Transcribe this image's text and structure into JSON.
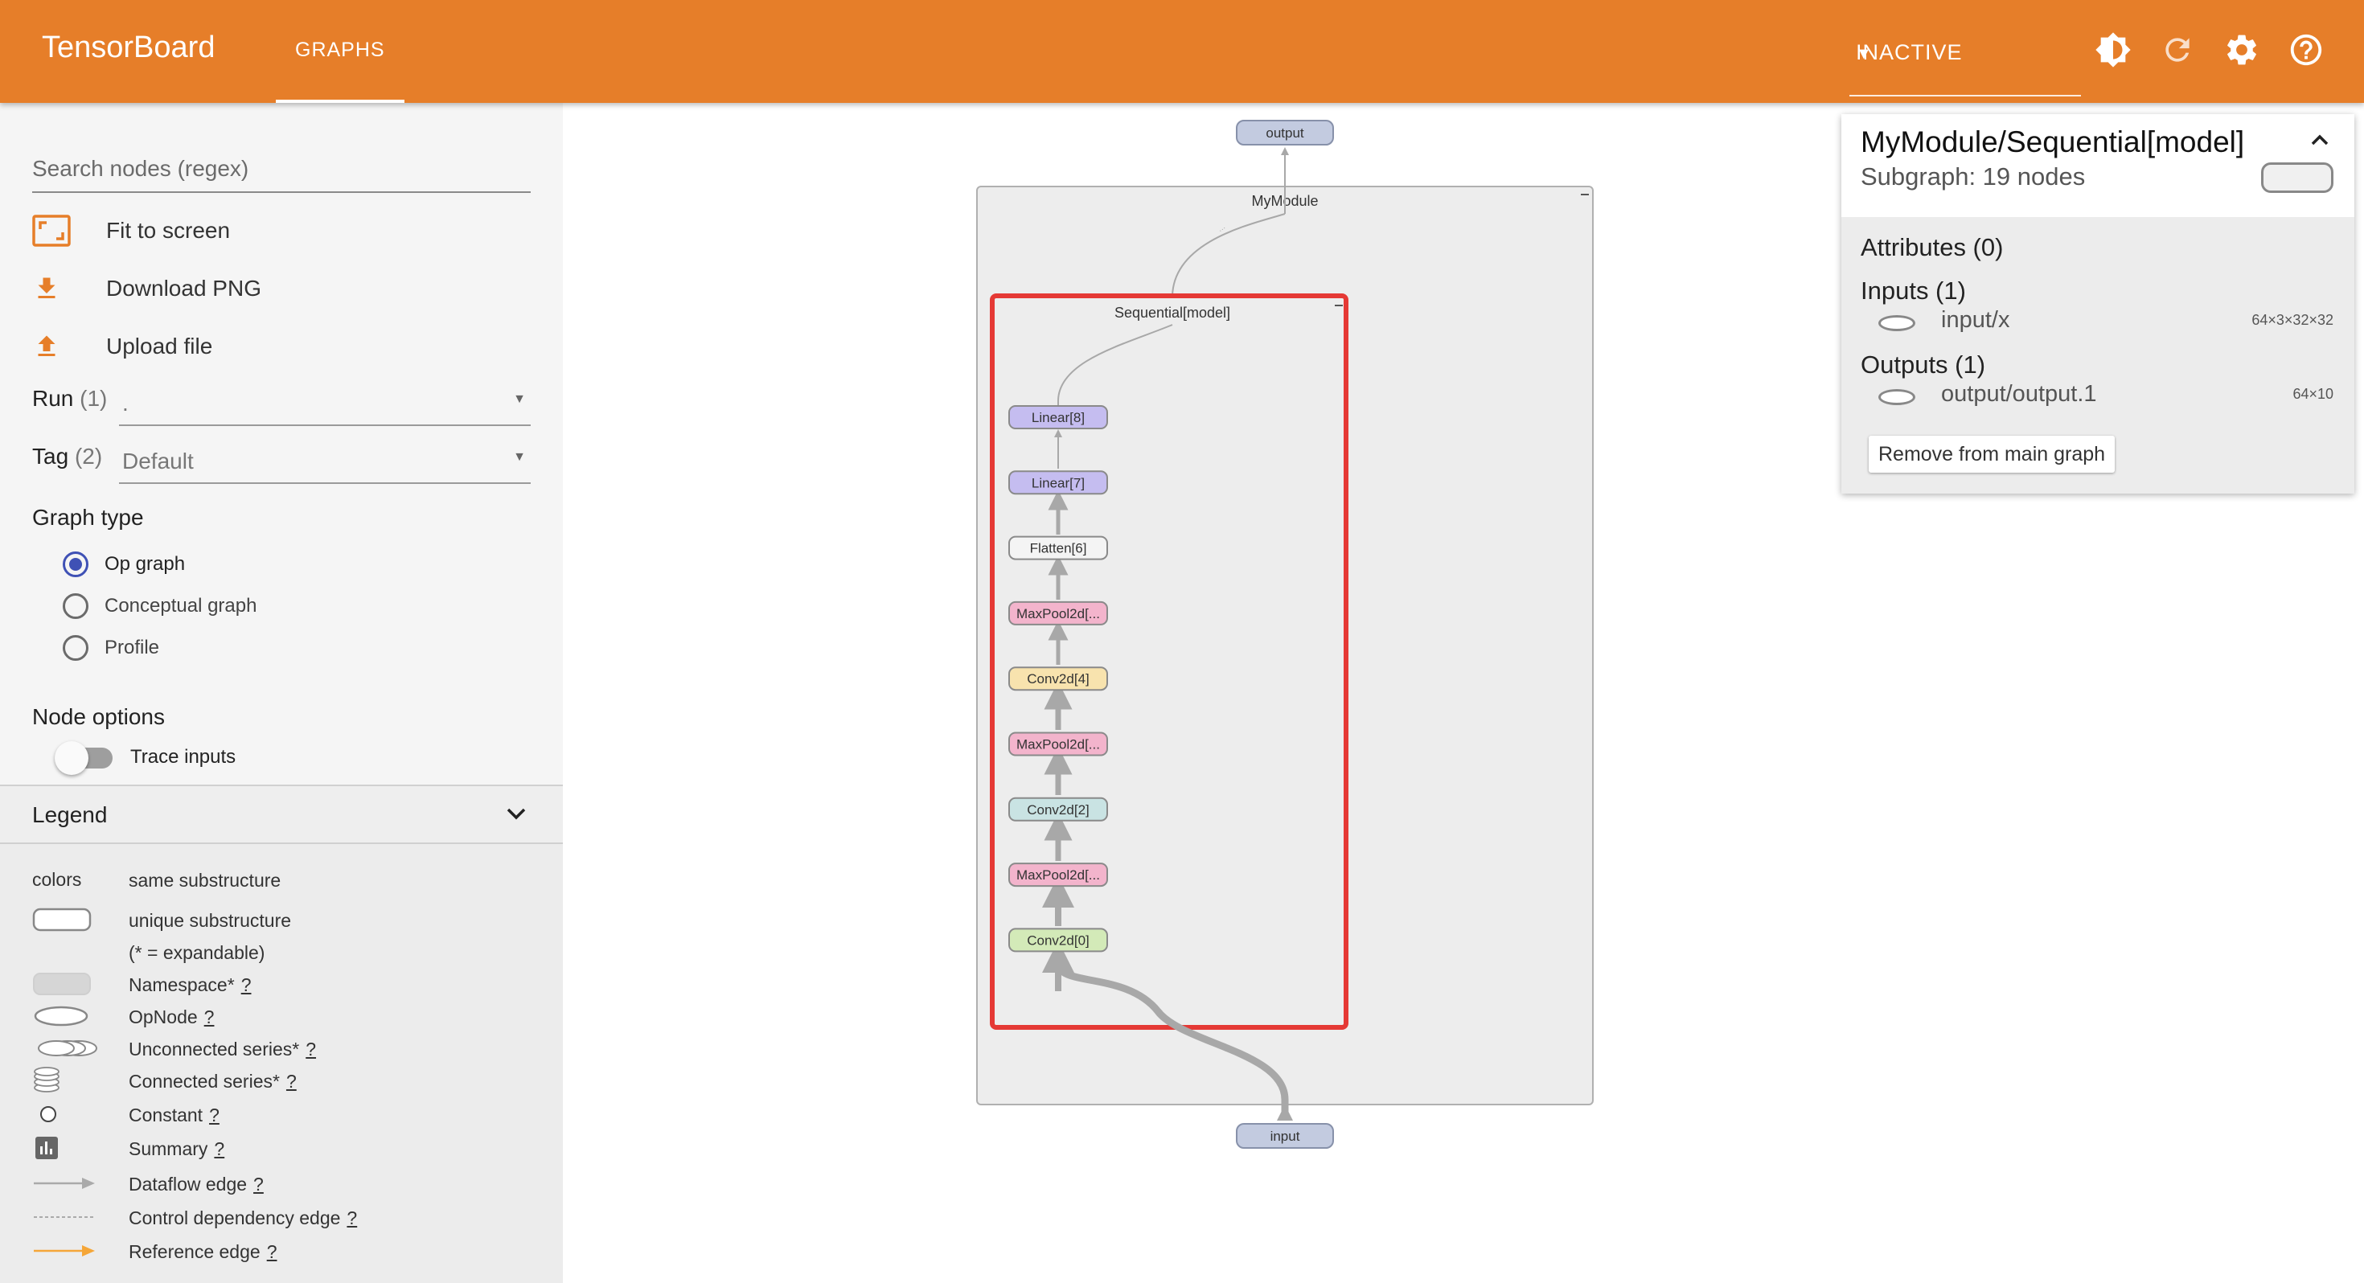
{
  "app": {
    "title": "TensorBoard",
    "tab": "GRAPHS"
  },
  "toolbar": {
    "run_status": "INACTIVE",
    "icons": [
      "brightness-icon",
      "refresh-icon",
      "settings-icon",
      "help-icon"
    ],
    "accent_color": "#e67e29"
  },
  "sidebar": {
    "search_placeholder": "Search nodes (regex)",
    "actions": [
      {
        "label": "Fit to screen",
        "icon": "fit-screen-icon"
      },
      {
        "label": "Download PNG",
        "icon": "download-icon"
      },
      {
        "label": "Upload file",
        "icon": "upload-icon"
      }
    ],
    "run": {
      "label": "Run",
      "count": "(1)",
      "value": "."
    },
    "tag": {
      "label": "Tag",
      "count": "(2)",
      "value": "Default"
    },
    "graph_type": {
      "title": "Graph type",
      "options": [
        "Op graph",
        "Conceptual graph",
        "Profile"
      ],
      "selected": "Op graph"
    },
    "node_options": {
      "title": "Node options",
      "trace_inputs": "Trace inputs"
    },
    "legend": {
      "title": "Legend",
      "header_col1": "colors",
      "header_col2": "same substructure",
      "rows": [
        {
          "label": "unique substructure",
          "help": ""
        },
        {
          "label": "(* = expandable)",
          "help": ""
        },
        {
          "label": "Namespace*",
          "help": "?"
        },
        {
          "label": "OpNode",
          "help": "?"
        },
        {
          "label": "Unconnected series*",
          "help": "?"
        },
        {
          "label": "Connected series*",
          "help": "?"
        },
        {
          "label": "Constant",
          "help": "?"
        },
        {
          "label": "Summary",
          "help": "?"
        },
        {
          "label": "Dataflow edge",
          "help": "?"
        },
        {
          "label": "Control dependency edge",
          "help": "?"
        },
        {
          "label": "Reference edge",
          "help": "?"
        }
      ]
    }
  },
  "graph": {
    "output_label": "output",
    "input_label": "input",
    "outer_module": "MyModule",
    "inner_module": "Sequential[model]",
    "nodes": [
      {
        "label": "Linear[8]",
        "color": "#c5bdf0"
      },
      {
        "label": "Linear[7]",
        "color": "#c5bdf0"
      },
      {
        "label": "Flatten[6]",
        "color": "#f4f4f4"
      },
      {
        "label": "MaxPool2d[...",
        "color": "#f3b4cc"
      },
      {
        "label": "Conv2d[4]",
        "color": "#f8e3ae"
      },
      {
        "label": "MaxPool2d[...",
        "color": "#f3b4cc"
      },
      {
        "label": "Conv2d[2]",
        "color": "#c9e3e3"
      },
      {
        "label": "MaxPool2d[...",
        "color": "#f3b4cc"
      },
      {
        "label": "Conv2d[0]",
        "color": "#d3eab8"
      }
    ],
    "io_color": "#c3cbe0",
    "selection_color": "#e53935"
  },
  "info_card": {
    "title": "MyModule/Sequential[model]",
    "subtitle": "Subgraph: 19 nodes",
    "attributes": "Attributes (0)",
    "inputs": "Inputs (1)",
    "input_name": "input/x",
    "input_shape": "64×3×32×32",
    "outputs": "Outputs (1)",
    "output_name": "output/output.1",
    "output_shape": "64×10",
    "button": "Remove from main graph"
  }
}
